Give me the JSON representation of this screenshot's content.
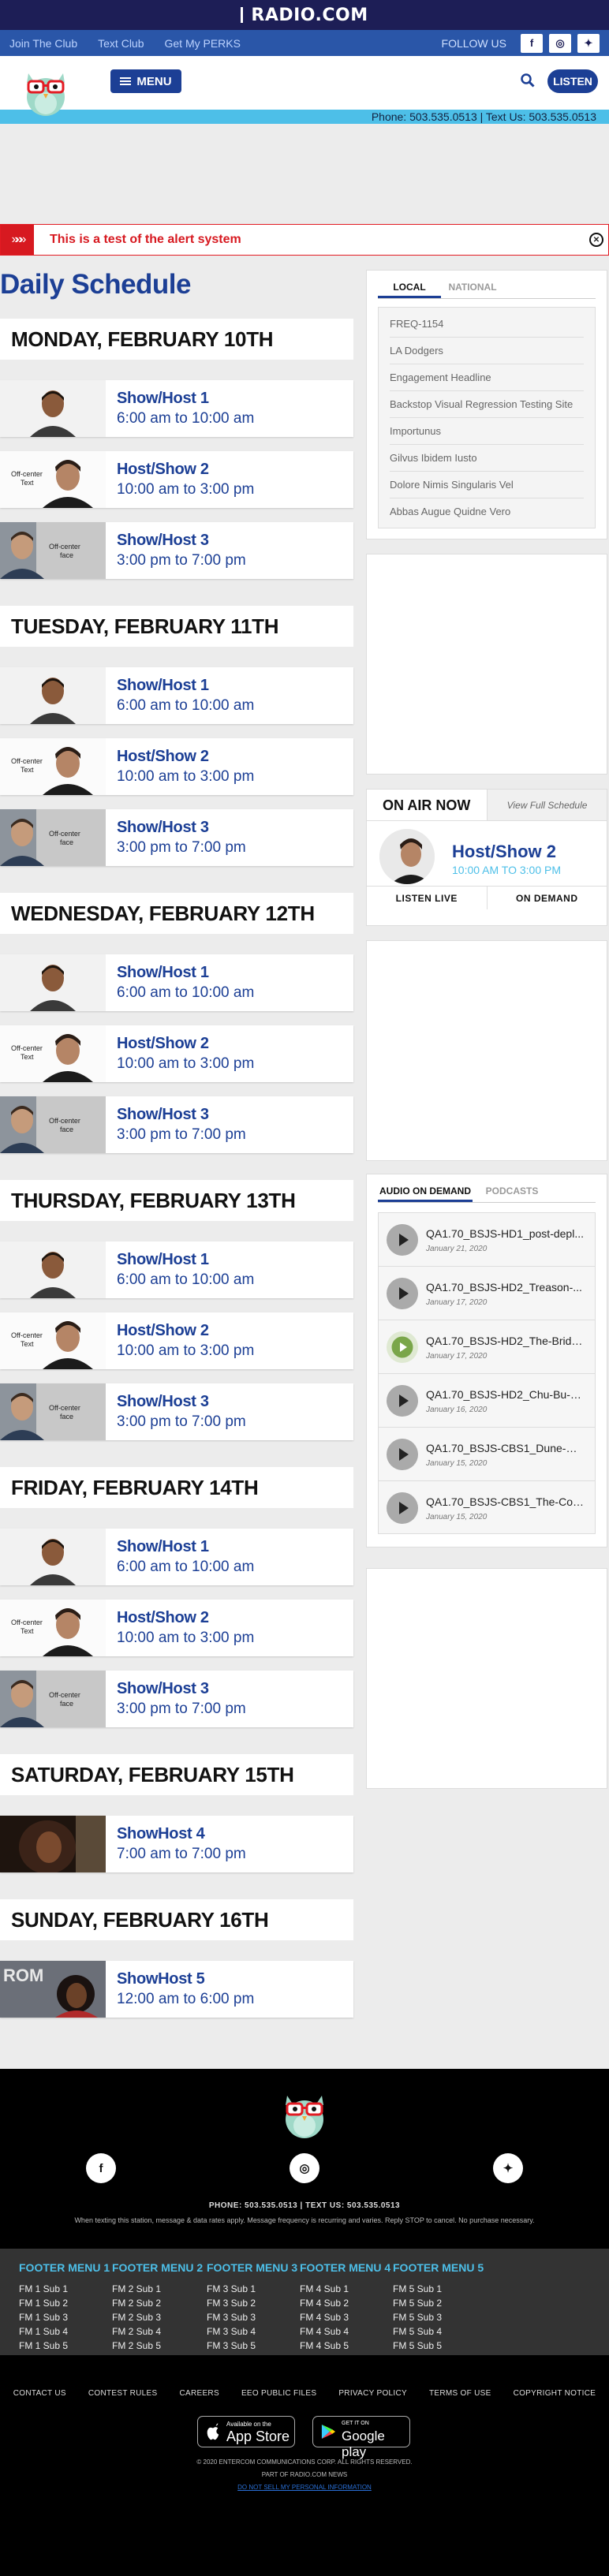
{
  "brand": {
    "name": "RADIO.COM"
  },
  "subbar": {
    "links": [
      "Join The Club",
      "Text Club",
      "Get My PERKS"
    ],
    "follow": "FOLLOW US"
  },
  "header": {
    "menu_label": "MENU",
    "listen_label": "LISTEN"
  },
  "phonebar": {
    "text": "Phone: 503.535.0513 | Text Us: 503.535.0513"
  },
  "alert": {
    "text": "This is a test of the alert system"
  },
  "page": {
    "title": "Daily Schedule"
  },
  "schedule": [
    {
      "day": "MONDAY, FEBRUARY 10TH",
      "shows": [
        {
          "name": "Show/Host 1",
          "time": "6:00 am to 10:00 am",
          "thumb": "host1"
        },
        {
          "name": "Host/Show 2",
          "time": "10:00 am to 3:00 pm",
          "thumb": "host2",
          "overlay": "Off-center Text"
        },
        {
          "name": "Show/Host 3",
          "time": "3:00 pm to 7:00 pm",
          "thumb": "host3",
          "overlay": "Off-center face"
        }
      ]
    },
    {
      "day": "TUESDAY, FEBRUARY 11TH",
      "shows": [
        {
          "name": "Show/Host 1",
          "time": "6:00 am to 10:00 am",
          "thumb": "host1"
        },
        {
          "name": "Host/Show 2",
          "time": "10:00 am to 3:00 pm",
          "thumb": "host2",
          "overlay": "Off-center Text"
        },
        {
          "name": "Show/Host 3",
          "time": "3:00 pm to 7:00 pm",
          "thumb": "host3",
          "overlay": "Off-center face"
        }
      ]
    },
    {
      "day": "WEDNESDAY, FEBRUARY 12TH",
      "shows": [
        {
          "name": "Show/Host 1",
          "time": "6:00 am to 10:00 am",
          "thumb": "host1"
        },
        {
          "name": "Host/Show 2",
          "time": "10:00 am to 3:00 pm",
          "thumb": "host2",
          "overlay": "Off-center Text"
        },
        {
          "name": "Show/Host 3",
          "time": "3:00 pm to 7:00 pm",
          "thumb": "host3",
          "overlay": "Off-center face"
        }
      ]
    },
    {
      "day": "THURSDAY, FEBRUARY 13TH",
      "shows": [
        {
          "name": "Show/Host 1",
          "time": "6:00 am to 10:00 am",
          "thumb": "host1"
        },
        {
          "name": "Host/Show 2",
          "time": "10:00 am to 3:00 pm",
          "thumb": "host2",
          "overlay": "Off-center Text"
        },
        {
          "name": "Show/Host 3",
          "time": "3:00 pm to 7:00 pm",
          "thumb": "host3",
          "overlay": "Off-center face"
        }
      ]
    },
    {
      "day": "FRIDAY, FEBRUARY 14TH",
      "shows": [
        {
          "name": "Show/Host 1",
          "time": "6:00 am to 10:00 am",
          "thumb": "host1"
        },
        {
          "name": "Host/Show 2",
          "time": "10:00 am to 3:00 pm",
          "thumb": "host2",
          "overlay": "Off-center Text"
        },
        {
          "name": "Show/Host 3",
          "time": "3:00 pm to 7:00 pm",
          "thumb": "host3",
          "overlay": "Off-center face"
        }
      ]
    },
    {
      "day": "SATURDAY, FEBRUARY 15TH",
      "shows": [
        {
          "name": "ShowHost 4",
          "time": "7:00 am to 7:00 pm",
          "thumb": "host4"
        }
      ]
    },
    {
      "day": "SUNDAY, FEBRUARY 16TH",
      "shows": [
        {
          "name": "ShowHost 5",
          "time": "12:00 am to 6:00 pm",
          "thumb": "host5"
        }
      ]
    }
  ],
  "sidebar": {
    "tabs": [
      "LOCAL",
      "NATIONAL"
    ],
    "links": [
      "FREQ-1154",
      "LA Dodgers",
      "Engagement Headline",
      "Backstop Visual Regression Testing Site",
      "Importunus",
      "Gilvus Ibidem Iusto",
      "Dolore Nimis Singularis Vel",
      "Abbas Augue Quidne Vero"
    ],
    "onair": {
      "title": "ON AIR NOW",
      "full_schedule": "View Full Schedule",
      "show": "Host/Show 2",
      "time": "10:00 AM TO 3:00 PM",
      "listen_live": "LISTEN LIVE",
      "on_demand": "ON DEMAND"
    },
    "aod": {
      "tabs": [
        "AUDIO ON DEMAND",
        "PODCASTS"
      ],
      "items": [
        {
          "title": "QA1.70_BSJS-HD1_post-depl...",
          "date": "January 21, 2020"
        },
        {
          "title": "QA1.70_BSJS-HD2_Treason-...",
          "date": "January 17, 2020"
        },
        {
          "title": "QA1.70_BSJS-HD2_The-Bride...",
          "date": "January 17, 2020",
          "logo": true
        },
        {
          "title": "QA1.70_BSJS-HD2_Chu-Bu-a...",
          "date": "January 16, 2020"
        },
        {
          "title": "QA1.70_BSJS-CBS1_Dune-Cl...",
          "date": "January 15, 2020"
        },
        {
          "title": "QA1.70_BSJS-CBS1_The-Cor...",
          "date": "January 15, 2020"
        }
      ]
    }
  },
  "footer": {
    "phone": "PHONE: 503.535.0513 | TEXT US: 503.535.0513",
    "disclaimer": "When texting this station, message & data rates apply. Message frequency is recurring and varies. Reply STOP to cancel. No purchase necessary.",
    "menus": [
      {
        "title": "FOOTER MENU 1",
        "items": [
          "FM 1 Sub 1",
          "FM 1 Sub 2",
          "FM 1 Sub 3",
          "FM 1 Sub 4",
          "FM 1 Sub 5"
        ]
      },
      {
        "title": "FOOTER MENU 2",
        "items": [
          "FM 2 Sub 1",
          "FM 2 Sub 2",
          "FM 2 Sub 3",
          "FM 2 Sub 4",
          "FM 2 Sub 5"
        ]
      },
      {
        "title": "FOOTER MENU 3",
        "items": [
          "FM 3 Sub 1",
          "FM 3 Sub 2",
          "FM 3 Sub 3",
          "FM 3 Sub 4",
          "FM 3 Sub 5"
        ]
      },
      {
        "title": "FOOTER MENU 4",
        "items": [
          "FM 4 Sub 1",
          "FM 4 Sub 2",
          "FM 4 Sub 3",
          "FM 4 Sub 4",
          "FM 4 Sub 5"
        ]
      },
      {
        "title": "FOOTER MENU 5",
        "items": [
          "FM 5 Sub 1",
          "FM 5 Sub 2",
          "FM 5 Sub 3",
          "FM 5 Sub 4",
          "FM 5 Sub 5"
        ]
      }
    ],
    "links": [
      "CONTACT US",
      "CONTEST RULES",
      "CAREERS",
      "EEO PUBLIC FILES",
      "PRIVACY POLICY",
      "TERMS OF USE",
      "COPYRIGHT NOTICE"
    ],
    "appstore": {
      "small": "Available on the",
      "big": "App Store"
    },
    "googleplay": {
      "small": "GET IT ON",
      "big": "Google play"
    },
    "copyright": "© 2020 ENTERCOM COMMUNICATIONS CORP. ALL RIGHTS RESERVED.",
    "part_of": "PART OF RADIO.COM NEWS",
    "do_not_sell": "DO NOT SELL MY PERSONAL INFORMATION"
  },
  "colors": {
    "brand_navy": "#1d1e56",
    "brand_blue": "#1c3f95",
    "sky": "#4dbfe8",
    "alert_red": "#d71920"
  }
}
